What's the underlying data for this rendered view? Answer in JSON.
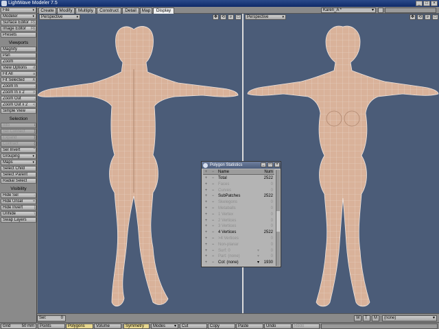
{
  "window": {
    "title": "LightWave Modeler 7.5",
    "controls": [
      "_",
      "□",
      "×"
    ]
  },
  "toptabs": [
    "Create",
    "Modify",
    "Multiply",
    "Construct",
    "Detail",
    "Map",
    "Display"
  ],
  "active_tab": "Display",
  "object_name": "Karen_A *",
  "sidebar": {
    "top_items": [
      {
        "label": "File",
        "dd": "▾"
      },
      {
        "label": "Modeler",
        "dd": "▾"
      },
      {
        "label": "Surface Editor",
        "sc": "F5"
      },
      {
        "label": "Image Editor",
        "sc": "F6"
      },
      {
        "label": "Presets"
      }
    ],
    "viewports_header": "Viewports",
    "viewports_items": [
      {
        "label": "Magnify"
      },
      {
        "label": "Pan"
      },
      {
        "label": "Zoom"
      },
      {
        "label": "View Options",
        "sc": "d"
      },
      {
        "label": "Fit All",
        "sc": "a"
      },
      {
        "label": "Fit Selected",
        "sc": "A"
      },
      {
        "label": "Zoom In",
        "sc": "."
      },
      {
        "label": "Zoom In x 2",
        "sc": ">"
      },
      {
        "label": "Zoom Out",
        "sc": ","
      },
      {
        "label": "Zoom Out x 2",
        "sc": "<"
      },
      {
        "label": "Simple View"
      }
    ],
    "selection_header": "Selection",
    "selection_items": [
      {
        "label": "Info",
        "sc": "i",
        "dis": true
      },
      {
        "label": "Sel Connect",
        "sc": "]",
        "dis": true
      },
      {
        "label": "Expand",
        "sc": "}",
        "dis": true
      },
      {
        "label": "Contract",
        "sc": "{",
        "dis": true
      },
      {
        "label": "Sel Invert",
        "sc": "\""
      },
      {
        "label": "Grouping",
        "dd": "▾"
      },
      {
        "label": "Maps",
        "dd": "▾"
      },
      {
        "label": "Select Child"
      },
      {
        "label": "Select Parent"
      },
      {
        "label": "Radial Select"
      }
    ],
    "visibility_header": "Visibility",
    "visibility_items": [
      {
        "label": "Hide Sel",
        "sc": "-"
      },
      {
        "label": "Hide Unsel",
        "sc": "="
      },
      {
        "label": "Hide Invert",
        "sc": "|"
      },
      {
        "label": "Unhide",
        "sc": "\\"
      },
      {
        "label": "Swap Layers"
      }
    ]
  },
  "viewports": {
    "left": {
      "view": "Perspective"
    },
    "right": {
      "view": "Perspective"
    }
  },
  "stats": {
    "title": "Polygon Statistics",
    "header": {
      "name": "Name",
      "num": "Num"
    },
    "rows": [
      {
        "name": "Total",
        "num": "2522",
        "dim": false
      },
      {
        "name": "Faces",
        "num": "0",
        "dim": true
      },
      {
        "name": "Curves",
        "num": "0",
        "dim": true
      },
      {
        "name": "SubPatches",
        "num": "2522",
        "dim": false
      },
      {
        "name": "Skelegons",
        "num": "0",
        "dim": true
      },
      {
        "name": "Metaballs",
        "num": "0",
        "dim": true
      },
      {
        "name": "1 Vertex",
        "num": "0",
        "dim": true
      },
      {
        "name": "2 Vertices",
        "num": "0",
        "dim": true
      },
      {
        "name": "3 Vertices",
        "num": "0",
        "dim": true
      },
      {
        "name": "4 Vertices",
        "num": "2522",
        "dim": false
      },
      {
        "name": ">4 Vertices",
        "num": "0",
        "dim": true
      },
      {
        "name": "Non-planar",
        "num": "0",
        "dim": true
      },
      {
        "name": "Surf: 0",
        "num": "0",
        "dim": true,
        "dd": "▾"
      },
      {
        "name": "Part: (none)",
        "num": "0",
        "dim": true,
        "dd": "▾"
      },
      {
        "name": "Col: (none)",
        "num": "1930",
        "dim": false,
        "dd": "▾"
      }
    ]
  },
  "bottom": {
    "sel_label": "Sel:",
    "sel_value": "0",
    "wtm": [
      "W",
      "T",
      "M"
    ],
    "map_value": "(none)"
  },
  "status": {
    "grid": "Grid",
    "grid_value": "50 mm",
    "modes": [
      "Points",
      "Polygons",
      "Volume"
    ],
    "symmetry": "Symmetry",
    "modes_menu": "Modes",
    "actions": [
      "Cut",
      "Copy",
      "Paste",
      "Undo",
      "Redo"
    ]
  },
  "colors": {
    "viewport": "#4b5c78",
    "skin": "#d9b29a",
    "wire": "#f0e8e4"
  }
}
